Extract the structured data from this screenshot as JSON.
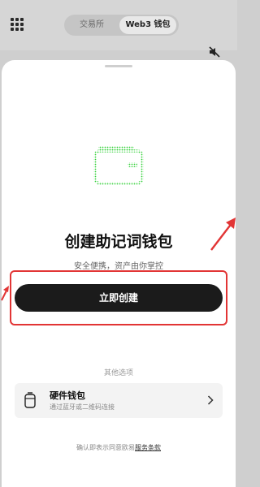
{
  "header": {
    "tabs": [
      {
        "label": "交易所"
      },
      {
        "label": "Web3 钱包"
      }
    ]
  },
  "sheet": {
    "title": "创建助记词钱包",
    "subtitle": "安全便携，资产由你掌控",
    "create_button": "立即创建",
    "other_options_label": "其他选项",
    "hardware_wallet": {
      "title": "硬件钱包",
      "subtitle": "通过蓝牙或二维码连接"
    },
    "terms_prefix": "确认即表示同意欧易",
    "terms_link": "服务条款"
  },
  "colors": {
    "accent_green": "#34d13a",
    "button_dark": "#1b1b1b",
    "annotation_red": "#e23535"
  }
}
